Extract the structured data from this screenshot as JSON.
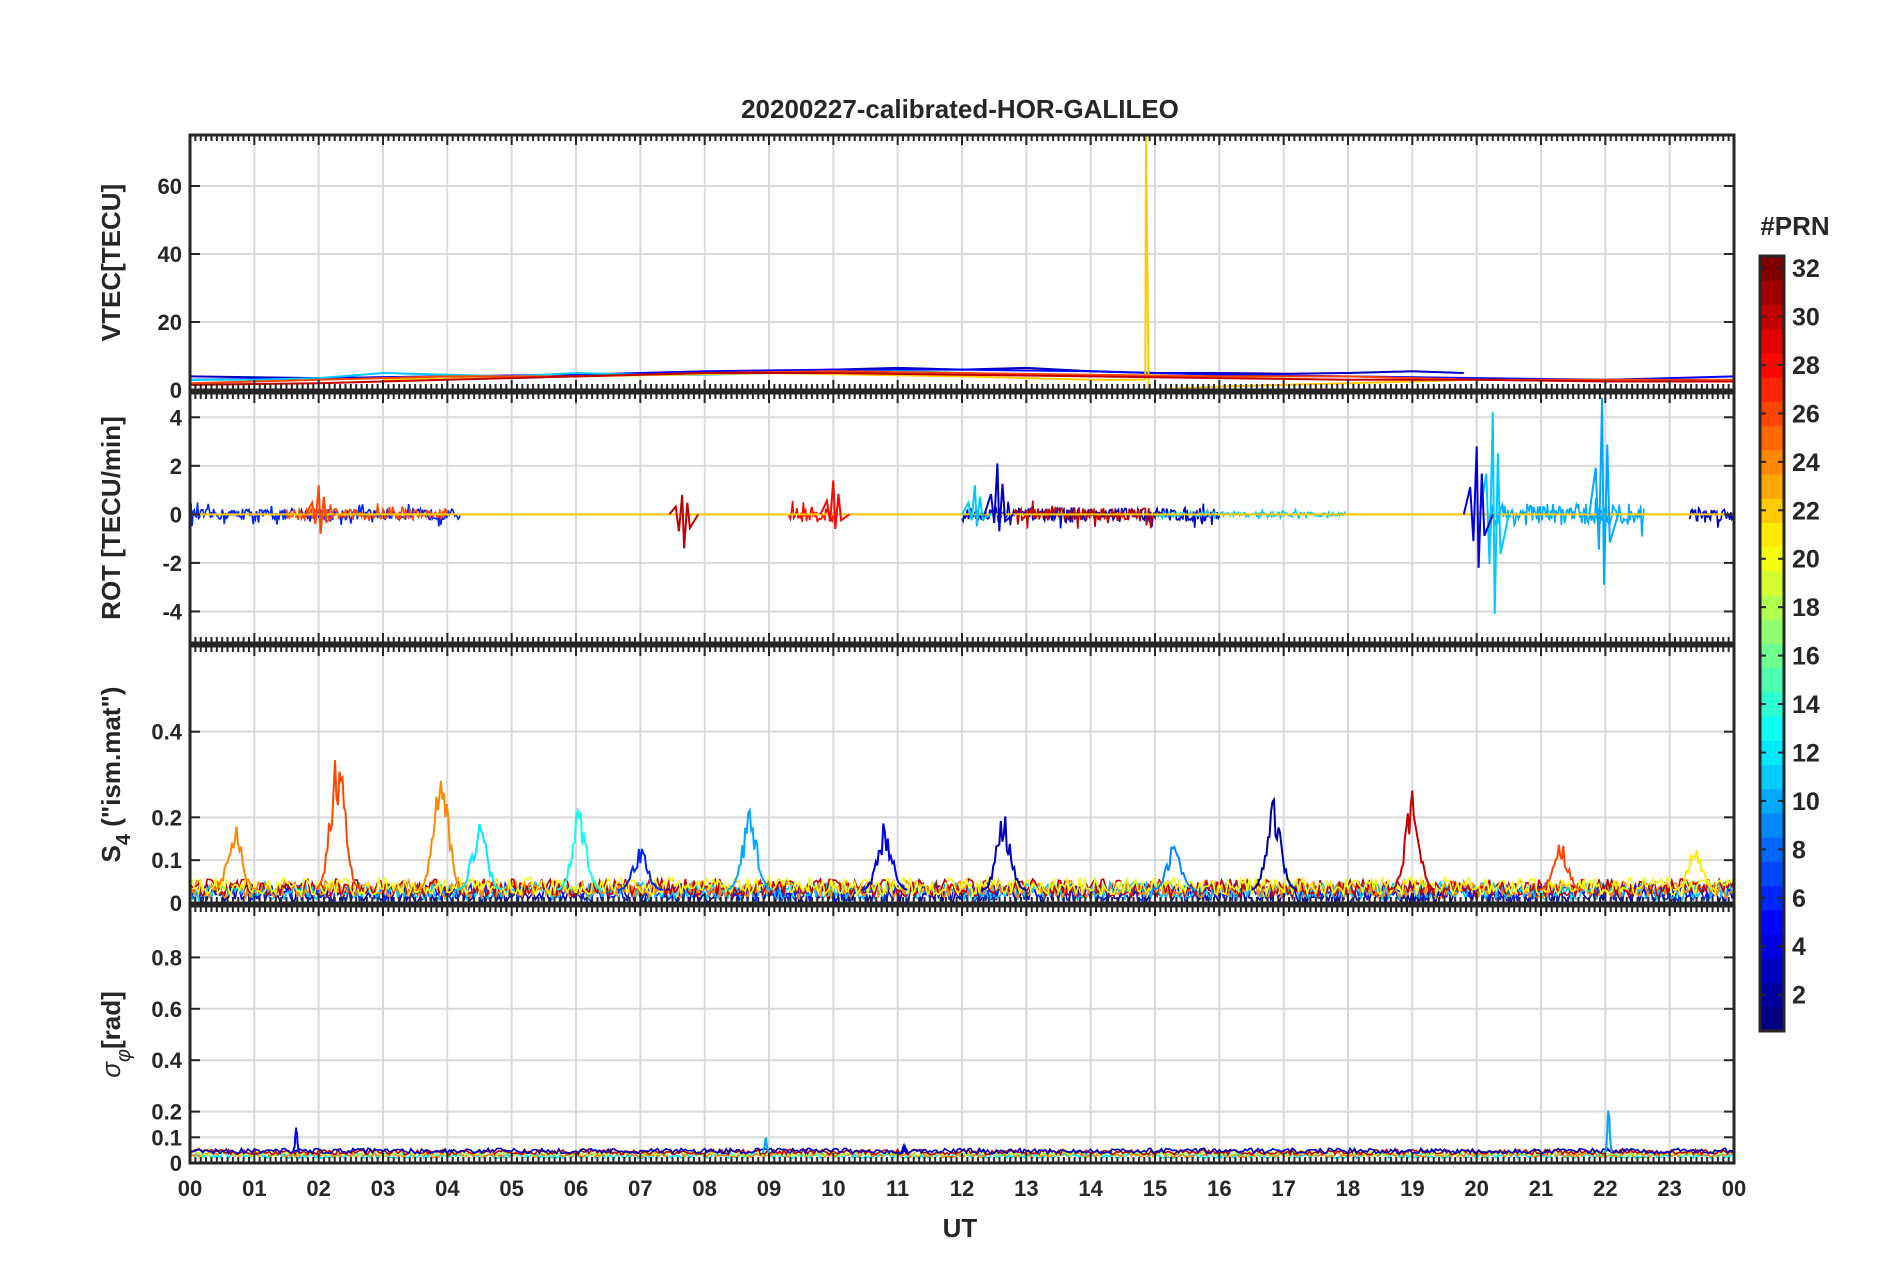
{
  "title": "20200227-calibrated-HOR-GALILEO",
  "colorbar": {
    "label": "#PRN",
    "ticks": [
      2,
      4,
      6,
      8,
      10,
      12,
      14,
      16,
      18,
      20,
      22,
      24,
      26,
      28,
      30,
      32
    ],
    "range": [
      1,
      32
    ]
  },
  "chart_data": {
    "type": "line",
    "xlabel": "UT",
    "x_tick_labels": [
      "00",
      "01",
      "02",
      "03",
      "04",
      "05",
      "06",
      "07",
      "08",
      "09",
      "10",
      "11",
      "12",
      "13",
      "14",
      "15",
      "16",
      "17",
      "18",
      "19",
      "20",
      "21",
      "22",
      "23",
      "00"
    ],
    "xlim": [
      0,
      24
    ],
    "panels": [
      {
        "id": "vtec",
        "ylabel": "VTEC[TECU]",
        "ylim": [
          0,
          75
        ],
        "yticks": [
          0,
          20,
          40,
          60
        ],
        "series": [
          {
            "prn": 3,
            "x": [
              0,
              2,
              4,
              6,
              8,
              10,
              11,
              12,
              13,
              14,
              15,
              16,
              17,
              18,
              19,
              19.8
            ],
            "y": [
              4,
              3.5,
              4,
              4.5,
              5,
              6,
              6.5,
              6,
              6.5,
              5.5,
              5,
              5,
              4.8,
              5,
              5.5,
              5
            ]
          },
          {
            "prn": 5,
            "x": [
              0,
              2,
              4,
              6,
              8,
              10,
              12,
              14,
              16,
              18,
              20,
              22,
              24
            ],
            "y": [
              3,
              3.5,
              4,
              4.5,
              5.5,
              6,
              6,
              5.5,
              4.5,
              4,
              3.5,
              3,
              4
            ]
          },
          {
            "prn": 11,
            "x": [
              0,
              1,
              2,
              3,
              4,
              5,
              6,
              7,
              8,
              9,
              10,
              11,
              12
            ],
            "y": [
              3,
              3,
              3.5,
              5,
              4.5,
              4,
              5,
              4.5,
              4.5,
              5,
              5,
              5.5,
              5
            ]
          },
          {
            "prn": 22,
            "x": [
              3,
              6,
              9,
              12,
              14,
              14.85,
              14.86,
              14.9,
              16,
              18,
              20
            ],
            "y": [
              3,
              4,
              5,
              4,
              3,
              3,
              75,
              0,
              1,
              2,
              3
            ]
          },
          {
            "prn": 26,
            "x": [
              0,
              2,
              4,
              6,
              8,
              10,
              12,
              14,
              16,
              18,
              20,
              22,
              24
            ],
            "y": [
              2,
              3,
              4,
              4,
              5,
              5.5,
              5,
              4.5,
              4,
              4,
              3,
              3,
              3
            ]
          },
          {
            "prn": 30,
            "x": [
              0,
              2,
              4,
              6,
              8,
              10,
              12,
              14,
              16,
              18,
              20,
              22,
              24
            ],
            "y": [
              1.5,
              2,
              3,
              4,
              5,
              5,
              4.5,
              4,
              3.5,
              3,
              3,
              2.5,
              2.5
            ]
          }
        ]
      },
      {
        "id": "rot",
        "ylabel": "ROT [TECU/min]",
        "ylim": [
          -5.3,
          5
        ],
        "yticks": [
          -4,
          -2,
          0,
          2,
          4
        ],
        "spikes": [
          {
            "prn": 11,
            "x": 20.25,
            "high": 4.2,
            "low": -4.1
          },
          {
            "prn": 10,
            "x": 21.95,
            "high": 4.8,
            "low": -2.9
          },
          {
            "prn": 4,
            "x": 20.0,
            "high": 2.8,
            "low": -2.2
          },
          {
            "prn": 3,
            "x": 12.55,
            "high": 2.1,
            "low": -0.7
          },
          {
            "prn": 26,
            "x": 2.0,
            "high": 1.2,
            "low": -0.8
          },
          {
            "prn": 28,
            "x": 10.0,
            "high": 1.4,
            "low": -0.6
          },
          {
            "prn": 30,
            "x": 7.65,
            "high": 0.8,
            "low": -1.4
          },
          {
            "prn": 11,
            "x": 12.2,
            "high": 1.2,
            "low": -0.5
          }
        ],
        "noise_bands": [
          {
            "prn": 6,
            "from": 0.0,
            "to": 4.2,
            "amp": 0.5
          },
          {
            "prn": 26,
            "from": 1.5,
            "to": 4.0,
            "amp": 0.5
          },
          {
            "prn": 28,
            "from": 9.3,
            "to": 10.0,
            "amp": 0.7
          },
          {
            "prn": 3,
            "from": 12.0,
            "to": 16.0,
            "amp": 0.6
          },
          {
            "prn": 30,
            "from": 12.8,
            "to": 15.0,
            "amp": 0.6
          },
          {
            "prn": 10,
            "from": 20.2,
            "to": 22.6,
            "amp": 1.0
          },
          {
            "prn": 3,
            "from": 23.3,
            "to": 24.0,
            "amp": 0.6
          },
          {
            "prn": 11,
            "from": 15.0,
            "to": 18.0,
            "amp": 0.2
          }
        ]
      },
      {
        "id": "s4",
        "ylabel": "S4 (\"ism.mat\")",
        "ylim": [
          0,
          0.6
        ],
        "yticks": [
          0,
          0.1,
          0.2,
          0.4
        ],
        "peaks": [
          {
            "prn": 26,
            "x": 2.3,
            "y": 0.39
          },
          {
            "prn": 24,
            "x": 3.9,
            "y": 0.34
          },
          {
            "prn": 24,
            "x": 0.7,
            "y": 0.19
          },
          {
            "prn": 12,
            "x": 4.5,
            "y": 0.2
          },
          {
            "prn": 13,
            "x": 6.05,
            "y": 0.23
          },
          {
            "prn": 10,
            "x": 8.7,
            "y": 0.22
          },
          {
            "prn": 4,
            "x": 10.8,
            "y": 0.19
          },
          {
            "prn": 3,
            "x": 12.65,
            "y": 0.21
          },
          {
            "prn": 2,
            "x": 16.85,
            "y": 0.25
          },
          {
            "prn": 30,
            "x": 19.0,
            "y": 0.27
          },
          {
            "prn": 26,
            "x": 21.3,
            "y": 0.15
          },
          {
            "prn": 21,
            "x": 23.4,
            "y": 0.13
          },
          {
            "prn": 9,
            "x": 15.3,
            "y": 0.14
          },
          {
            "prn": 6,
            "x": 7.0,
            "y": 0.13
          }
        ],
        "baseline": 0.03
      },
      {
        "id": "sigphi",
        "ylabel": "σφ[rad]",
        "ylim": [
          0,
          1
        ],
        "yticks": [
          0,
          0.1,
          0.2,
          0.4,
          0.6,
          0.8
        ],
        "peaks": [
          {
            "prn": 5,
            "x": 1.65,
            "y": 0.14
          },
          {
            "prn": 10,
            "x": 8.95,
            "y": 0.1
          },
          {
            "prn": 10,
            "x": 22.05,
            "y": 0.22
          },
          {
            "prn": 4,
            "x": 11.1,
            "y": 0.07
          }
        ],
        "baseline": 0.04
      }
    ]
  }
}
